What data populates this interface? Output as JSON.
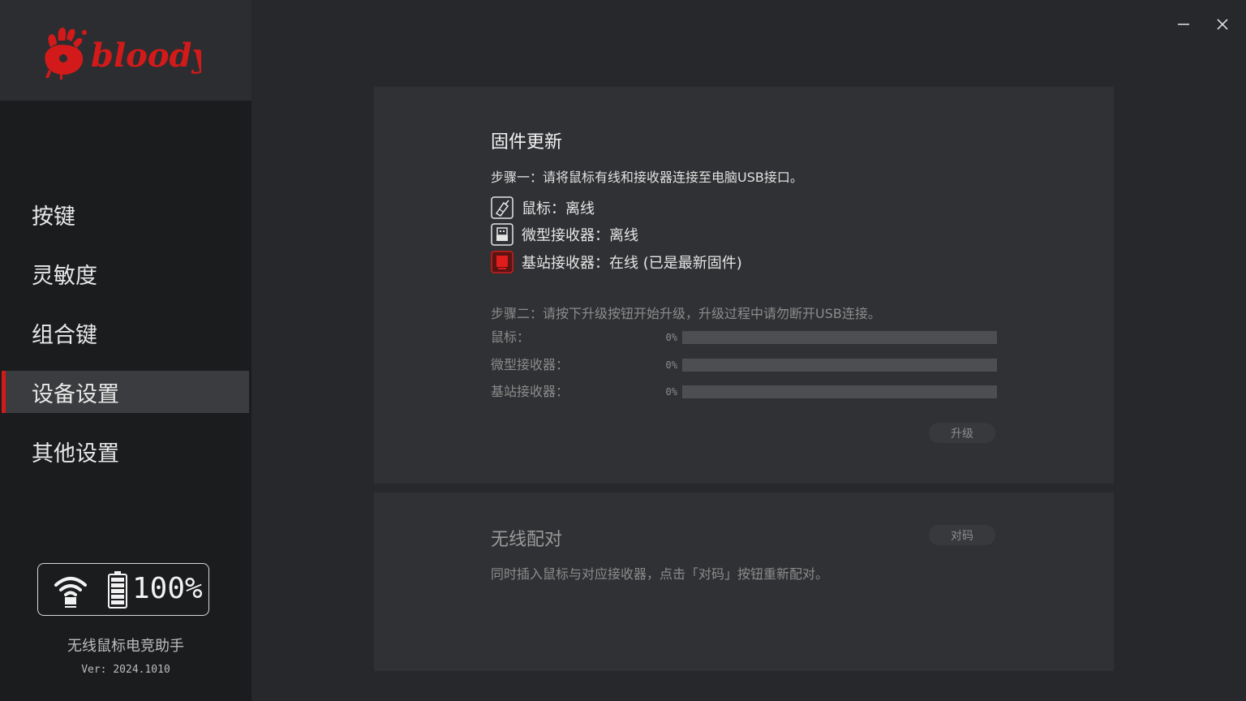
{
  "brand": {
    "logo_text": "bloody",
    "accent_color": "#d31a1a"
  },
  "nav": {
    "items": [
      {
        "label": "按键"
      },
      {
        "label": "灵敏度"
      },
      {
        "label": "组合键"
      },
      {
        "label": "设备设置",
        "active": true
      },
      {
        "label": "其他设置"
      }
    ]
  },
  "device_status": {
    "battery_percent": "100%",
    "wifi_icon": "wifi-icon",
    "battery_icon": "battery-icon"
  },
  "app": {
    "name": "无线鼠标电竞助手",
    "version": "Ver: 2024.1010"
  },
  "window_controls": {
    "minimize_icon": "minimize-icon",
    "close_icon": "close-icon"
  },
  "firmware": {
    "title": "固件更新",
    "step1": "步骤一：请将鼠标有线和接收器连接至电脑USB接口。",
    "devices": [
      {
        "label": "鼠标：离线",
        "icon": "mouse-icon"
      },
      {
        "label": "微型接收器：离线",
        "icon": "usb-receiver-icon"
      },
      {
        "label": "基站接收器：在线 (已是最新固件)",
        "icon": "base-station-icon",
        "status_color": "#d31a1a"
      }
    ],
    "step2": "步骤二：请按下升级按钮开始升级，升级过程中请勿断开USB连接。",
    "progress": [
      {
        "label": "鼠标：",
        "percent_text": "0%",
        "value": 0
      },
      {
        "label": "微型接收器：",
        "percent_text": "0%",
        "value": 0
      },
      {
        "label": "基站接收器：",
        "percent_text": "0%",
        "value": 0
      }
    ],
    "upgrade_button": "升级"
  },
  "pairing": {
    "title": "无线配对",
    "pair_button": "对码",
    "description": "同时插入鼠标与对应接收器，点击「对码」按钮重新配对。"
  }
}
